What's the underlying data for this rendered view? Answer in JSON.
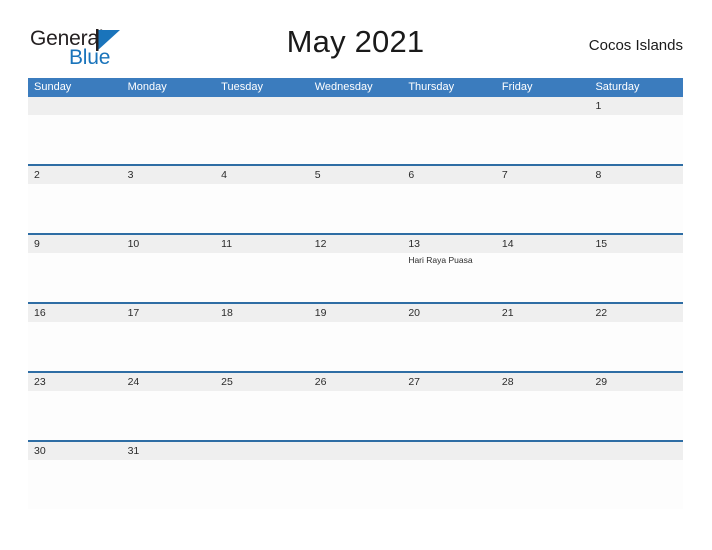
{
  "brand": {
    "name_part1": "General",
    "name_part2": "Blue",
    "color_dark": "#231f20",
    "color_blue": "#1a74bb"
  },
  "header": {
    "title": "May 2021",
    "region": "Cocos Islands"
  },
  "theme": {
    "header_bar": "#3b7cbe",
    "row_divider": "#2e6da4",
    "day_band": "#efefef",
    "cell_bg": "#ffffff"
  },
  "calendar": {
    "weekdays": [
      "Sunday",
      "Monday",
      "Tuesday",
      "Wednesday",
      "Thursday",
      "Friday",
      "Saturday"
    ],
    "weeks": [
      [
        {
          "day": ""
        },
        {
          "day": ""
        },
        {
          "day": ""
        },
        {
          "day": ""
        },
        {
          "day": ""
        },
        {
          "day": ""
        },
        {
          "day": "1"
        }
      ],
      [
        {
          "day": "2"
        },
        {
          "day": "3"
        },
        {
          "day": "4"
        },
        {
          "day": "5"
        },
        {
          "day": "6"
        },
        {
          "day": "7"
        },
        {
          "day": "8"
        }
      ],
      [
        {
          "day": "9"
        },
        {
          "day": "10"
        },
        {
          "day": "11"
        },
        {
          "day": "12"
        },
        {
          "day": "13",
          "event": "Hari Raya Puasa"
        },
        {
          "day": "14"
        },
        {
          "day": "15"
        }
      ],
      [
        {
          "day": "16"
        },
        {
          "day": "17"
        },
        {
          "day": "18"
        },
        {
          "day": "19"
        },
        {
          "day": "20"
        },
        {
          "day": "21"
        },
        {
          "day": "22"
        }
      ],
      [
        {
          "day": "23"
        },
        {
          "day": "24"
        },
        {
          "day": "25"
        },
        {
          "day": "26"
        },
        {
          "day": "27"
        },
        {
          "day": "28"
        },
        {
          "day": "29"
        }
      ],
      [
        {
          "day": "30"
        },
        {
          "day": "31"
        },
        {
          "day": ""
        },
        {
          "day": ""
        },
        {
          "day": ""
        },
        {
          "day": ""
        },
        {
          "day": ""
        }
      ]
    ]
  }
}
